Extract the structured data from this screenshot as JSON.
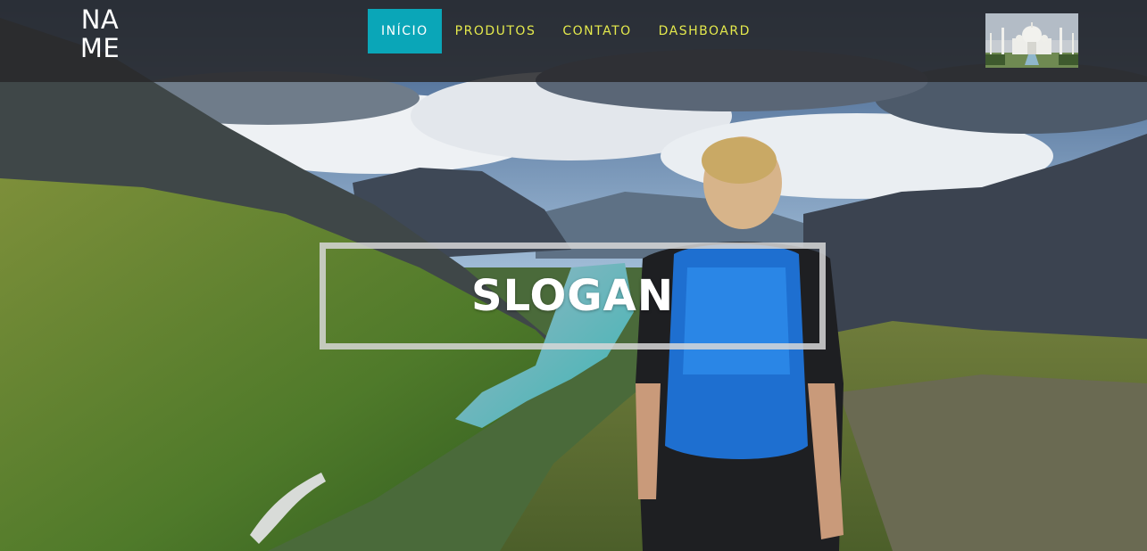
{
  "brand": {
    "name": "NA ME",
    "line1": "NA",
    "line2": "ME"
  },
  "nav": {
    "items": [
      {
        "label": "INÍCIO",
        "active": true
      },
      {
        "label": "PRODUTOS",
        "active": false
      },
      {
        "label": "CONTATO",
        "active": false
      },
      {
        "label": "DASHBOARD",
        "active": false
      }
    ]
  },
  "hero": {
    "slogan": "SLOGAN"
  },
  "thumbnail": {
    "icon": "taj-mahal-photo"
  },
  "colors": {
    "nav_bar": "#28282a",
    "nav_active_bg": "#0aa6b8",
    "nav_link": "#e4e94c",
    "slogan_border": "#d7d7d7",
    "text_light": "#ffffff"
  }
}
